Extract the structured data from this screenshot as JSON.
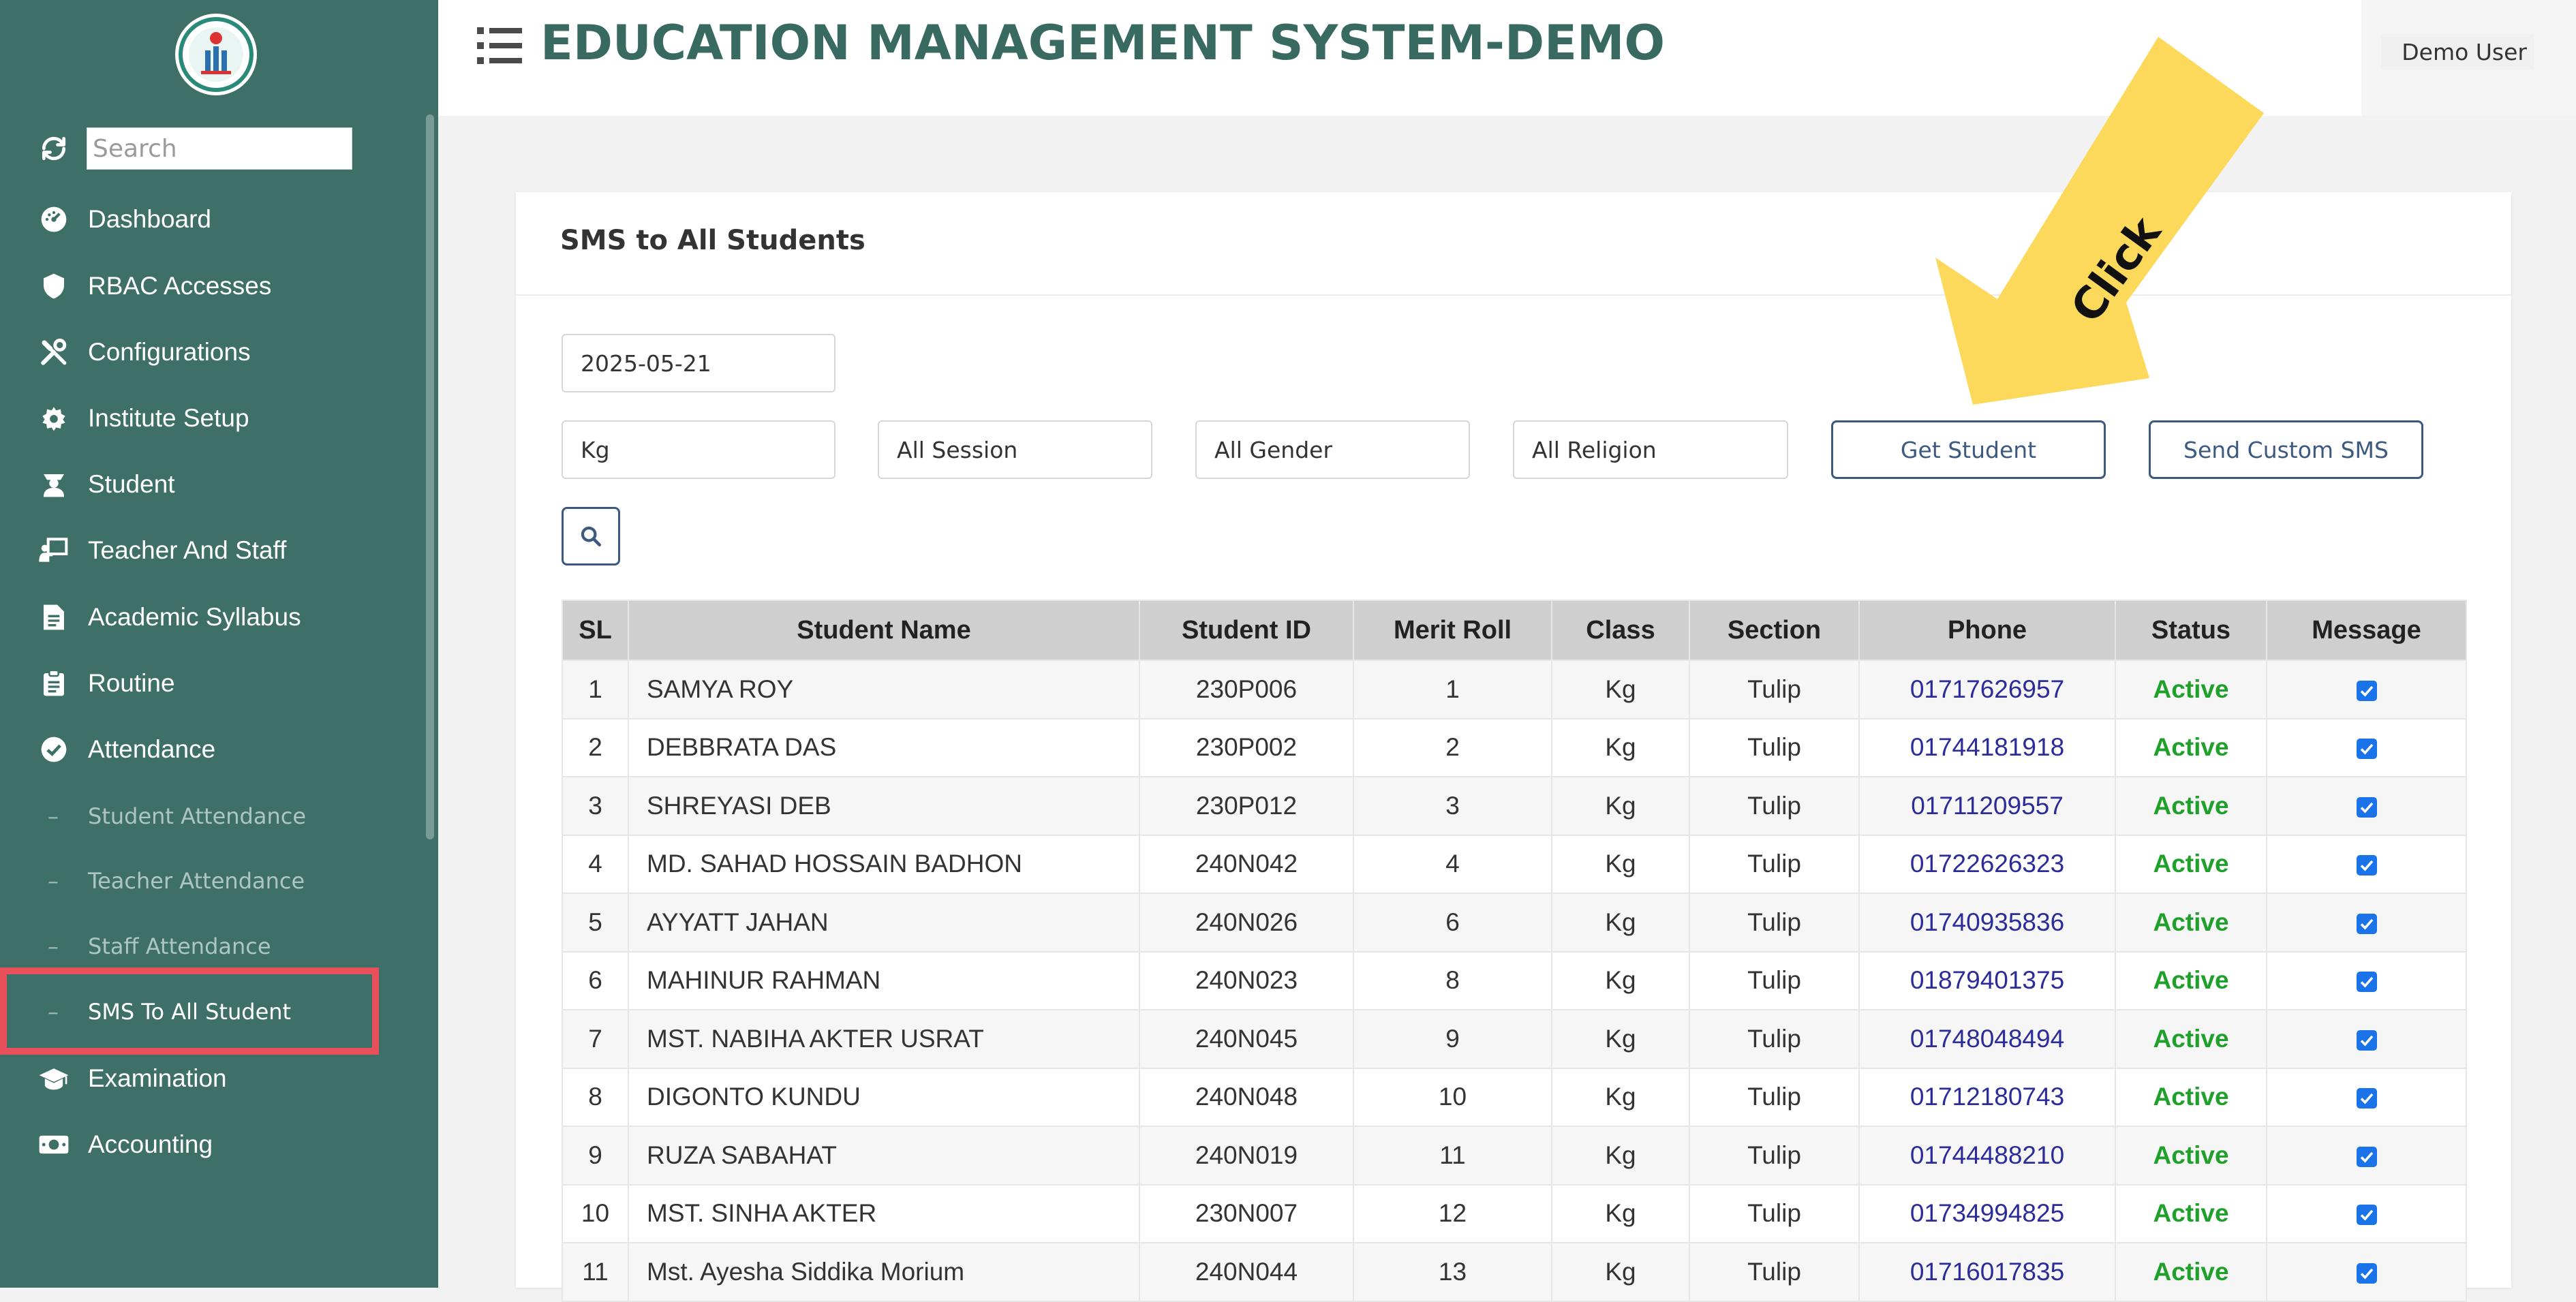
{
  "header": {
    "title": "EDUCATION MANAGEMENT SYSTEM-DEMO",
    "user": "Demo User"
  },
  "sidebar": {
    "search_placeholder": "Search",
    "items": [
      {
        "label": "Dashboard",
        "icon": "dashboard-icon"
      },
      {
        "label": "RBAC Accesses",
        "icon": "shield-icon"
      },
      {
        "label": "Configurations",
        "icon": "tools-icon"
      },
      {
        "label": "Institute Setup",
        "icon": "gear-icon"
      },
      {
        "label": "Student",
        "icon": "student-icon"
      },
      {
        "label": "Teacher And Staff",
        "icon": "teacher-icon"
      },
      {
        "label": "Academic Syllabus",
        "icon": "document-icon"
      },
      {
        "label": "Routine",
        "icon": "clipboard-icon"
      },
      {
        "label": "Attendance",
        "icon": "check-circle-icon"
      },
      {
        "label": "Examination",
        "icon": "graduation-cap-icon"
      },
      {
        "label": "Accounting",
        "icon": "money-icon"
      }
    ],
    "attendance_sub": [
      {
        "label": "Student Attendance"
      },
      {
        "label": "Teacher Attendance"
      },
      {
        "label": "Staff Attendance"
      },
      {
        "label": "SMS To All Student"
      }
    ]
  },
  "card": {
    "title": "SMS to All Students",
    "date": "2025-05-21",
    "class_value": "Kg",
    "session_value": "All Session",
    "gender_value": "All Gender",
    "religion_value": "All Religion",
    "get_student_label": "Get Student",
    "send_custom_label": "Send Custom SMS"
  },
  "annotation": {
    "text": "Click",
    "color": "#fcd95a"
  },
  "table": {
    "headers": [
      "SL",
      "Student Name",
      "Student ID",
      "Merit Roll",
      "Class",
      "Section",
      "Phone",
      "Status",
      "Message"
    ],
    "rows": [
      {
        "sl": "1",
        "name": "SAMYA ROY",
        "id": "230P006",
        "roll": "1",
        "class": "Kg",
        "section": "Tulip",
        "phone": "01717626957",
        "status": "Active"
      },
      {
        "sl": "2",
        "name": "DEBBRATA DAS",
        "id": "230P002",
        "roll": "2",
        "class": "Kg",
        "section": "Tulip",
        "phone": "01744181918",
        "status": "Active"
      },
      {
        "sl": "3",
        "name": "SHREYASI DEB",
        "id": "230P012",
        "roll": "3",
        "class": "Kg",
        "section": "Tulip",
        "phone": "01711209557",
        "status": "Active"
      },
      {
        "sl": "4",
        "name": "MD. SAHAD HOSSAIN BADHON",
        "id": "240N042",
        "roll": "4",
        "class": "Kg",
        "section": "Tulip",
        "phone": "01722626323",
        "status": "Active"
      },
      {
        "sl": "5",
        "name": "AYYATT JAHAN",
        "id": "240N026",
        "roll": "6",
        "class": "Kg",
        "section": "Tulip",
        "phone": "01740935836",
        "status": "Active"
      },
      {
        "sl": "6",
        "name": "MAHINUR RAHMAN",
        "id": "240N023",
        "roll": "8",
        "class": "Kg",
        "section": "Tulip",
        "phone": "01879401375",
        "status": "Active"
      },
      {
        "sl": "7",
        "name": "MST. NABIHA AKTER USRAT",
        "id": "240N045",
        "roll": "9",
        "class": "Kg",
        "section": "Tulip",
        "phone": "01748048494",
        "status": "Active"
      },
      {
        "sl": "8",
        "name": "DIGONTO KUNDU",
        "id": "240N048",
        "roll": "10",
        "class": "Kg",
        "section": "Tulip",
        "phone": "01712180743",
        "status": "Active"
      },
      {
        "sl": "9",
        "name": "RUZA SABAHAT",
        "id": "240N019",
        "roll": "11",
        "class": "Kg",
        "section": "Tulip",
        "phone": "01744488210",
        "status": "Active"
      },
      {
        "sl": "10",
        "name": "MST. SINHA AKTER",
        "id": "230N007",
        "roll": "12",
        "class": "Kg",
        "section": "Tulip",
        "phone": "01734994825",
        "status": "Active"
      },
      {
        "sl": "11",
        "name": "Mst. Ayesha Siddika Morium",
        "id": "240N044",
        "roll": "13",
        "class": "Kg",
        "section": "Tulip",
        "phone": "01716017835",
        "status": "Active"
      }
    ]
  }
}
